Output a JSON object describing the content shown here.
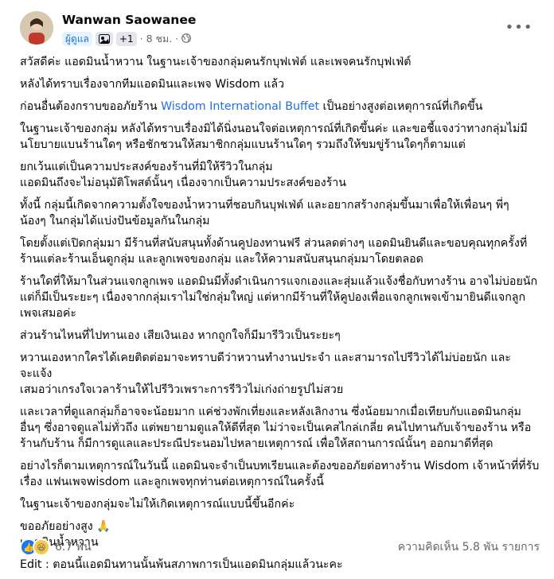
{
  "post": {
    "author": "Wanwan Saowanee",
    "admin_badge": "ผู้ดูแล",
    "plus_count": "+1",
    "time": "· 8 ชม. ·",
    "more_label": "•••"
  },
  "paragraphs": [
    {
      "lines": [
        "สวัสดีค่ะ แอดมินน้ำหวาน ในฐานะเจ้าของกลุ่มคนรักบุฟเฟ่ต์ และเพจคนรักบุฟเฟ่ต์"
      ]
    },
    {
      "lines": [
        "หลังได้ทราบเรื่องจากทีมแอดมินและเพจ Wisdom แล้ว"
      ]
    },
    {
      "lines": [
        "ก่อนอื่นต้องกราบขออภัยร้าน"
      ],
      "link": "Wisdom International Buffet",
      "after": "เป็นอย่างสูงต่อเหตุการณ์ที่เกิดขึ้น"
    },
    {
      "lines": [
        "ในฐานะเจ้าของกลุ่ม หลังได้ทราบเรื่องมิได้นิ่งนอนใจต่อเหตุการณ์ที่เกิดขึ้นค่ะ และขอชี้แจงว่าทางกลุ่มไม่มี",
        "นโยบายแบนร้านใดๆ หรือชักชวนให้สมาชิกกลุ่มแบนร้านใดๆ รวมถึงให้ขมขู่ร้านใดๆก็ตามแต่"
      ]
    },
    {
      "lines": [
        "ยกเว้นแต่เป็นความประสงค์ของร้านที่มิให้รีวิวในกลุ่ม",
        "แอดมินถึงจะไม่อนุมัติโพสต์นั้นๆ เนื่องจากเป็นความประสงค์ของร้าน"
      ]
    },
    {
      "lines": [
        "ทั้งนี้ กลุ่มนี้เกิดจากความตั้งใจของน้ำหวานที่ชอบกินบุฟเฟ่ต์ และอยากสร้างกลุ่มขึ้นมาเพื่อให้เพื่อนๆ พี่ๆ",
        "น้องๆ ในกลุ่มได้แบ่งปันข้อมูลกันในกลุ่ม"
      ]
    },
    {
      "lines": [
        "โดยตั้งแต่เปิดกลุ่มมา มีร้านที่สนับสนุนทั้งด้านคูปองทานฟรี ส่วนลดต่างๆ แอดมินยินดีและขอบคุณทุกครั้งที่",
        "ร้านแต่ละร้านเอ็นดูกลุ่ม และลูกเพจของกลุ่ม และให้ความสนับสนุนกลุ่มมาโดยตลอด"
      ]
    },
    {
      "lines": [
        "ร้านใดที่ให้มาในส่วนแจกลูกเพจ แอดมินมีทั้งดำเนินการแจกเองและสุ่มแล้วแจ้งชื่อกับทางร้าน อาจไม่บ่อยนัก",
        "แต่ก็มีเป็นระยะๆ เนื่องจากกลุ่มเราไม่ใช่กลุ่มใหญ่ แต่หากมีร้านที่ให้คูปองเพื่อแจกลูกเพจเข้ามายินดีแจกลูก",
        "เพจเสมอค่ะ"
      ]
    },
    {
      "lines": [
        "ส่วนร้านไหนที่ไปทานเอง เสียเงินเอง หากถูกใจก็มีมารีวิวเป็นระยะๆ"
      ]
    },
    {
      "lines": [
        "หวานเองหากใครได้เคยติดต่อมาจะทราบดีว่าหวานทำงานประจำ และสามารถไปรีวิวได้ไม่บ่อยนัก และจะแจ้ง",
        "เสมอว่าเกรงใจเวลาร้านให้ไปรีวิวเพราะการรีวิวไม่เก่งถ่ายรูปไม่สวย"
      ]
    },
    {
      "lines": [
        "และเวลาที่ดูแลกลุ่มก็อาจจะน้อยมาก แค่ช่วงพักเที่ยงและหลังเลิกงาน ซึ่งน้อยมากเมื่อเทียบกับแอดมินกลุ่ม",
        "อื่นๆ ซึ่งอาจดูแลไม่ทั่วถึง แต่พยายามดูแลให้ดีที่สุด ไม่ว่าจะเป็นเคสไกล่เกลี่ย คนไปทานกับเจ้าของร้าน หรือ",
        "ร้านกับร้าน ก็มีการดูแลและประณีประนอมไปหลายเหตุการณ์ เพื่อให้สถานการณ์นั้นๆ ออกมาดีที่สุด"
      ]
    },
    {
      "lines": [
        "อย่างไรก็ตามเหตุการณ์ในวันนี้ แอดมินจะจำเป็นบทเรียนและต้องขออภัยต่อทางร้าน Wisdom เจ้าหน้าที่ที่รับ",
        "เรื่อง แฟนเพจwisdom และลูกเพจทุกท่านต่อเหตุการณ์ในครั้งนี้"
      ]
    },
    {
      "lines": [
        "ในฐานะเจ้าของกลุ่มจะไม่ให้เกิดเหตุการณ์แบบนี้ขึ้นอีกค่ะ"
      ]
    },
    {
      "lines": [
        "ขออภัยอย่างสูง 🙏",
        "แอดมินน้ำหวาน"
      ]
    },
    {
      "lines": [
        "Edit : ตอนนี้แอดมินทานนั้นพ้นสภาพการเป็นแอดมินกลุ่มแล้วนะคะ"
      ]
    }
  ],
  "footer": {
    "reactions_count": "6.7 พัน",
    "comments_label": "ความคิดเห็น 5.8 พัน รายการ"
  },
  "colors": {
    "link": "#216fdb",
    "admin_badge_bg": "#e7f3ff",
    "admin_badge_text": "#1b74e4",
    "like": "#1877f2",
    "haha": "#f7c948"
  }
}
